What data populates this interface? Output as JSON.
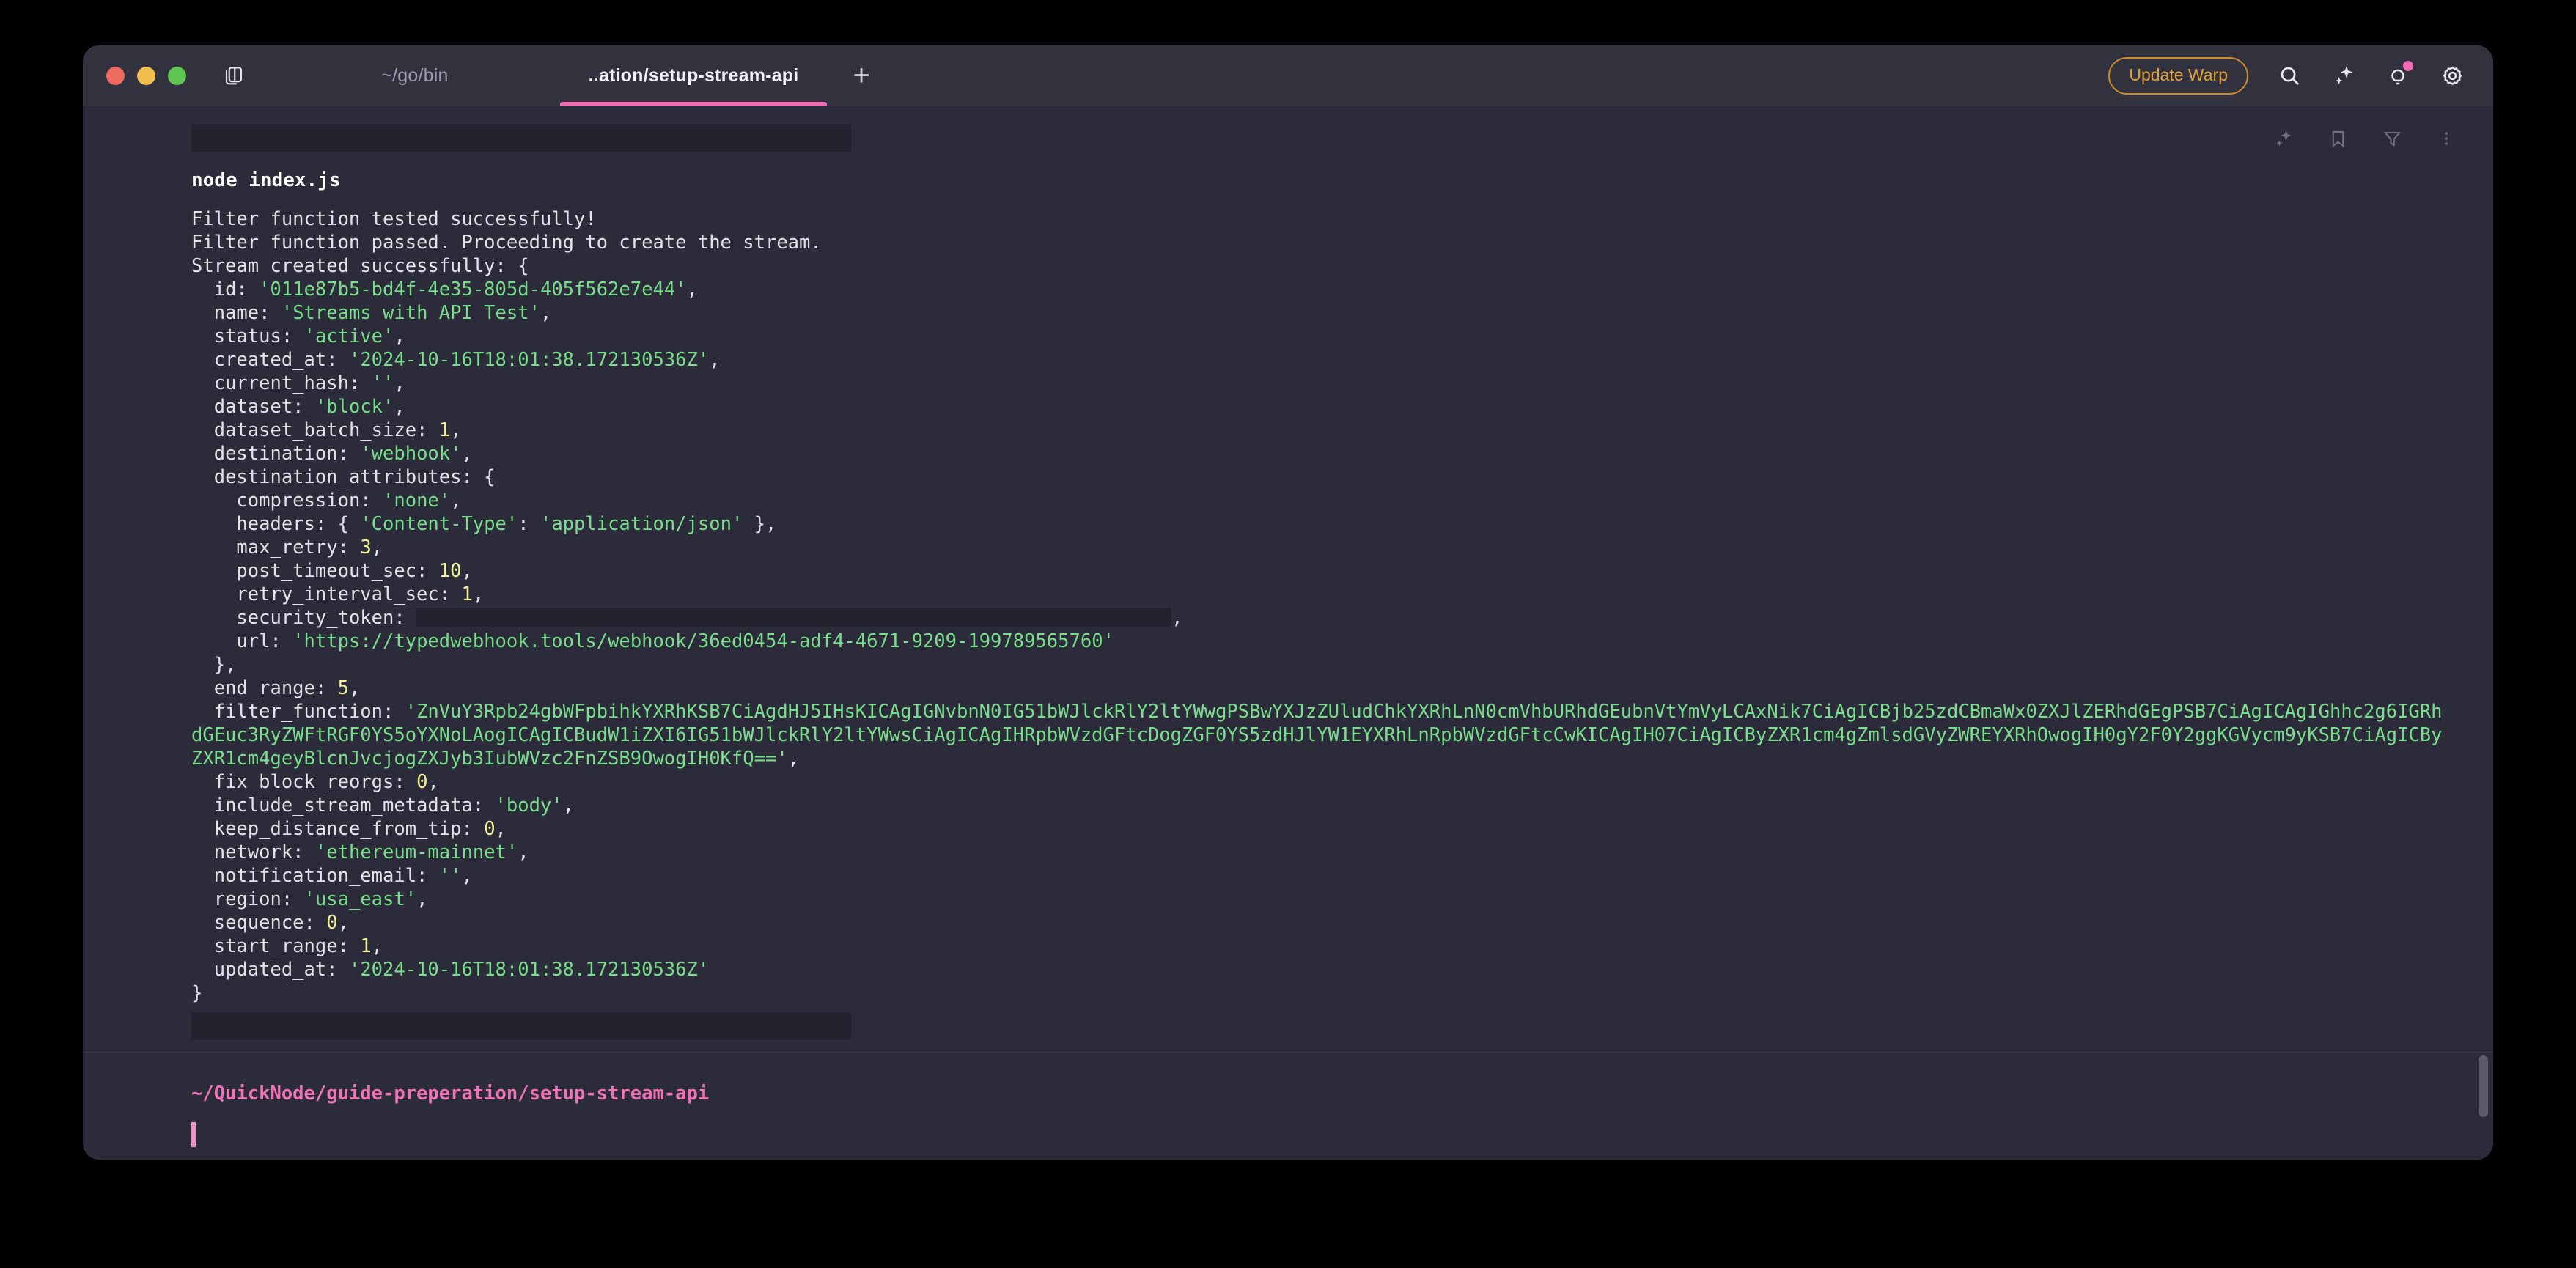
{
  "window": {
    "traffic_lights": [
      "close",
      "minimize",
      "maximize"
    ],
    "panes_icon": "split-panes-icon"
  },
  "titlebar": {
    "tabs": [
      {
        "label": "~/go/bin",
        "active": false
      },
      {
        "label": "..ation/setup-stream-api",
        "active": true
      }
    ],
    "new_tab_label": "+",
    "update_button_label": "Update Warp",
    "icons": [
      "search-icon",
      "sparkle-icon",
      "lightbulb-icon",
      "gear-icon"
    ],
    "notification_dot_color": "#F06BB4",
    "accent_color": "#F06BB4",
    "update_button_color": "#E0A23A"
  },
  "block_toolbar": {
    "icons": [
      "sparkle-icon",
      "bookmark-icon",
      "filter-icon",
      "more-options-icon"
    ]
  },
  "terminal": {
    "command": "node index.js",
    "output_lines": [
      "Filter function tested successfully!",
      "Filter function passed. Proceeding to create the stream.",
      "Stream created successfully: {"
    ],
    "json_fields": [
      {
        "indent": 2,
        "key": "id:",
        "value": "'011e87b5-bd4f-4e35-805d-405f562e7e44'",
        "type": "str",
        "comma": true
      },
      {
        "indent": 2,
        "key": "name:",
        "value": "'Streams with API Test'",
        "type": "str",
        "comma": true
      },
      {
        "indent": 2,
        "key": "status:",
        "value": "'active'",
        "type": "str",
        "comma": true
      },
      {
        "indent": 2,
        "key": "created_at:",
        "value": "'2024-10-16T18:01:38.172130536Z'",
        "type": "str",
        "comma": true
      },
      {
        "indent": 2,
        "key": "current_hash:",
        "value": "''",
        "type": "str",
        "comma": true
      },
      {
        "indent": 2,
        "key": "dataset:",
        "value": "'block'",
        "type": "str",
        "comma": true
      },
      {
        "indent": 2,
        "key": "dataset_batch_size:",
        "value": "1",
        "type": "num",
        "comma": true
      },
      {
        "indent": 2,
        "key": "destination:",
        "value": "'webhook'",
        "type": "str",
        "comma": true
      },
      {
        "indent": 2,
        "key": "destination_attributes:",
        "value": "{",
        "type": "plain",
        "comma": false
      },
      {
        "indent": 4,
        "key": "compression:",
        "value": "'none'",
        "type": "str",
        "comma": true
      },
      {
        "indent": 4,
        "key": "headers:",
        "value": "{ 'Content-Type': 'application/json' },",
        "type": "headers",
        "comma": false
      },
      {
        "indent": 4,
        "key": "max_retry:",
        "value": "3",
        "type": "num",
        "comma": true
      },
      {
        "indent": 4,
        "key": "post_timeout_sec:",
        "value": "10",
        "type": "num",
        "comma": true
      },
      {
        "indent": 4,
        "key": "retry_interval_sec:",
        "value": "1",
        "type": "num",
        "comma": true
      },
      {
        "indent": 4,
        "key": "security_token:",
        "value": "",
        "type": "redacted",
        "comma": true
      },
      {
        "indent": 4,
        "key": "url:",
        "value": "'https://typedwebhook.tools/webhook/36ed0454-adf4-4671-9209-199789565760'",
        "type": "str",
        "comma": false
      },
      {
        "indent": 2,
        "key": "},",
        "value": "",
        "type": "plain",
        "comma": false
      },
      {
        "indent": 2,
        "key": "end_range:",
        "value": "5",
        "type": "num",
        "comma": true
      },
      {
        "indent": 2,
        "key": "filter_function:",
        "value": "'ZnVuY3Rpb24gbWFpbihkYXRhKSB7CiAgdHJ5IHsKICAgIGNvbnN0IG51bWJlckRlY2ltYWwgPSBwYXJzZUludChkYXRhLnN0cmVhbURhdGEubnVtYmVyLCAxNik7CiAgICBjb25zdCBmaWx0ZXJlZERhdGEgPSB7CiAgICAgIGhhc2g6IGRhdGEuc3RyZWFtRGF0YS5oYXNoLAogICAgICBudW1iZXI6IG51bWJlckRlY2ltYWwsCiAgICAgIHRpbWVzdGFtcDogZGF0YS5zdHJlYW1EYXRhLnRpbWVzdGFtcCwKICAgIH07CiAgICByZXR1cm4gZmlsdGVyZWREYXRhOwogIH0gY2F0Y2ggKGVycm9yKSB7CiAgICByZXR1cm4geyBlcnJvcjogZXJyb3IubWVzc2FnZSB9OwogIH0KfQ=='",
        "type": "str",
        "comma": true,
        "wrap": true
      },
      {
        "indent": 2,
        "key": "fix_block_reorgs:",
        "value": "0",
        "type": "num",
        "comma": true
      },
      {
        "indent": 2,
        "key": "include_stream_metadata:",
        "value": "'body'",
        "type": "str",
        "comma": true
      },
      {
        "indent": 2,
        "key": "keep_distance_from_tip:",
        "value": "0",
        "type": "num",
        "comma": true
      },
      {
        "indent": 2,
        "key": "network:",
        "value": "'ethereum-mainnet'",
        "type": "str",
        "comma": true
      },
      {
        "indent": 2,
        "key": "notification_email:",
        "value": "''",
        "type": "str",
        "comma": true
      },
      {
        "indent": 2,
        "key": "region:",
        "value": "'usa_east'",
        "type": "str",
        "comma": true
      },
      {
        "indent": 2,
        "key": "sequence:",
        "value": "0",
        "type": "num",
        "comma": true
      },
      {
        "indent": 2,
        "key": "start_range:",
        "value": "1",
        "type": "num",
        "comma": true
      },
      {
        "indent": 2,
        "key": "updated_at:",
        "value": "'2024-10-16T18:01:38.172130536Z'",
        "type": "str",
        "comma": false
      }
    ],
    "closing_brace": "}",
    "prompt_path": "~/QuickNode/guide-preperation/setup-stream-api",
    "input_value": "",
    "colors": {
      "background": "#2B2B39",
      "text": "#E2E2EA",
      "string": "#79DE8C",
      "number": "#F2F29A",
      "prompt": "#ED74B6",
      "cursor": "#F48FC8"
    }
  }
}
